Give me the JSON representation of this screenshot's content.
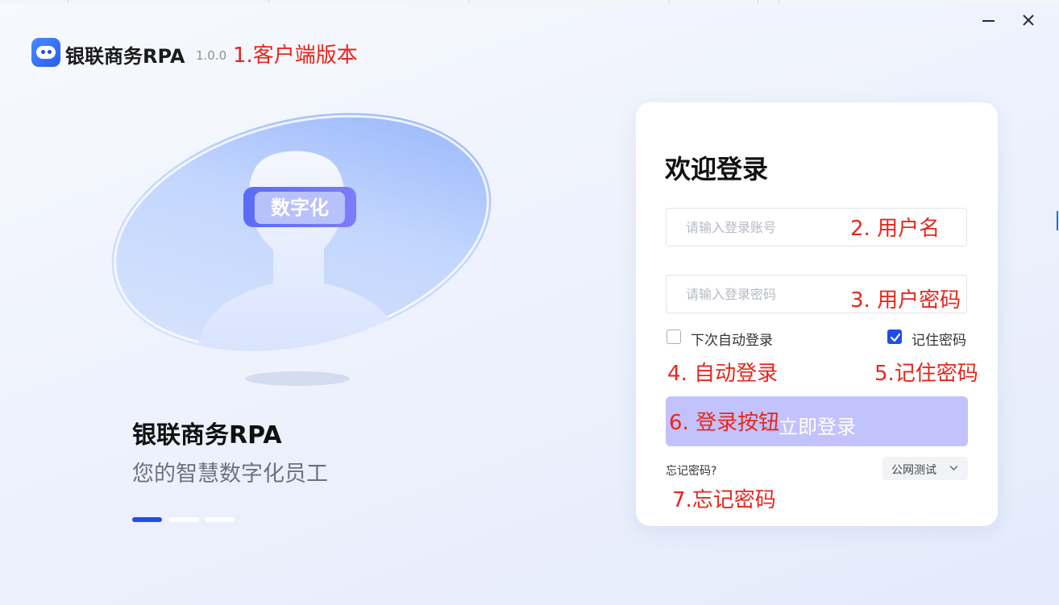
{
  "window": {
    "minimize_icon": "minimize-icon",
    "close_icon": "close-icon"
  },
  "header": {
    "logo_icon": "robot-logo-icon",
    "app_name": "银联商务RPA",
    "version": "1.0.0"
  },
  "hero": {
    "visor_text": "数字化",
    "brand_name": "银联商务RPA",
    "slogan": "您的智慧数字化员工",
    "carousel_count": 3,
    "carousel_active": 1
  },
  "login": {
    "welcome": "欢迎登录",
    "username_placeholder": "请输入登录账号",
    "username_value": "",
    "password_placeholder": "请输入登录密码",
    "password_value": "",
    "auto_login_label": "下次自动登录",
    "auto_login_checked": false,
    "remember_label": "记住密码",
    "remember_checked": true,
    "submit_label": "立即登录",
    "forgot_label": "忘记密码?",
    "environment": "公网测试"
  },
  "annotations": {
    "a1": "1.客户端版本",
    "a2": "2. 用户名",
    "a3": "3. 用户密码",
    "a4": "4. 自动登录",
    "a5": "5.记住密码",
    "a6": "6. 登录按钮",
    "a7": "7.忘记密码"
  },
  "colors": {
    "accent": "#1f4fe8",
    "annotation": "#e8261c",
    "button_disabled": "#c2c2fc"
  }
}
